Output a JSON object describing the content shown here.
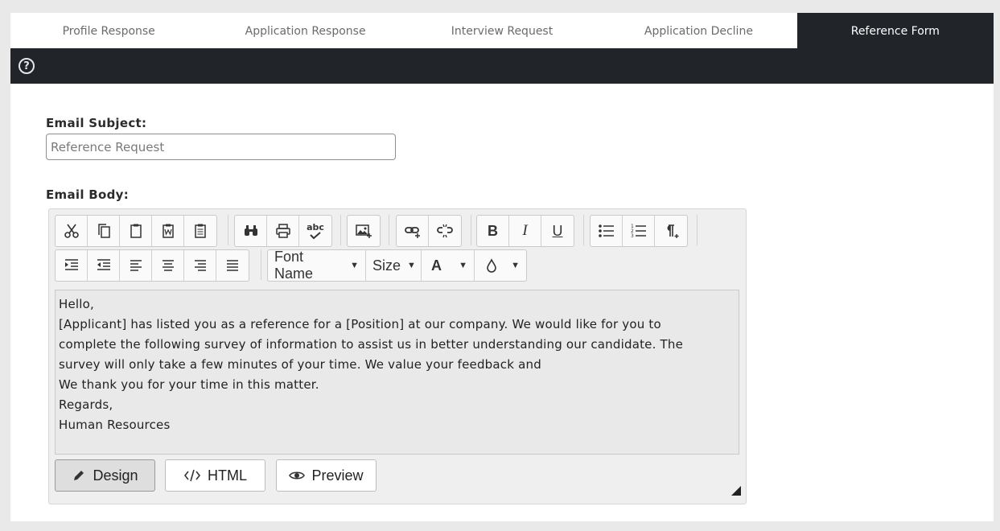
{
  "tabs": [
    {
      "label": "Profile Response",
      "active": false
    },
    {
      "label": "Application Response",
      "active": false
    },
    {
      "label": "Interview Request",
      "active": false
    },
    {
      "label": "Application Decline",
      "active": false
    },
    {
      "label": "Reference Form",
      "active": true
    }
  ],
  "toolbar": {
    "help_glyph": "?"
  },
  "form": {
    "subject_label": "Email Subject:",
    "subject_placeholder": "Reference Request",
    "subject_value": "",
    "body_label": "Email Body:"
  },
  "editor": {
    "row1_icons": [
      [
        "cut-icon",
        "copy-icon",
        "paste-icon",
        "paste-word-icon",
        "paste-text-icon"
      ],
      [
        "find-icon",
        "print-icon",
        "spellcheck-icon"
      ],
      [
        "insert-image-icon"
      ],
      [
        "insert-link-icon",
        "remove-link-icon"
      ],
      [
        "bold-icon",
        "italic-icon",
        "underline-icon"
      ],
      [
        "bullet-list-icon",
        "numbered-list-icon",
        "paragraph-icon"
      ]
    ],
    "row2_icons": [
      "indent-icon",
      "outdent-icon",
      "align-left-icon",
      "align-center-icon",
      "align-right-icon",
      "justify-icon"
    ],
    "font_name": "Font Name",
    "font_size": "Size",
    "font_color_glyph": "A",
    "spell_text": "abc",
    "bold_glyph": "B",
    "italic_glyph": "I",
    "underline_glyph": "U",
    "body_lines": [
      "Hello,",
      "[Applicant] has listed you as a reference for a [Position] at our company.  We would like for you to",
      "complete the following survey of information to assist us in better understanding our candidate.  The",
      "survey will only take a few minutes of your time.  We value your feedback and",
      "We thank you for your time in this matter.",
      "Regards,",
      "Human Resources"
    ],
    "modes": [
      {
        "label": "Design",
        "icon": "pencil-icon",
        "active": true
      },
      {
        "label": "HTML",
        "icon": "code-icon",
        "active": false
      },
      {
        "label": "Preview",
        "icon": "eye-icon",
        "active": false
      }
    ]
  }
}
